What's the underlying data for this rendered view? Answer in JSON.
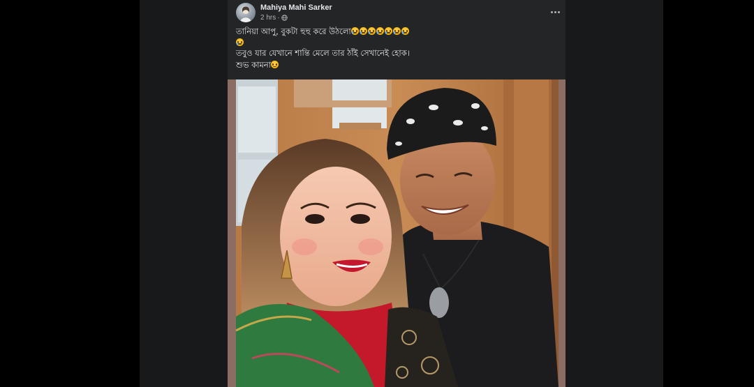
{
  "post": {
    "author": "Mahiya Mahi Sarker",
    "time": "2 hrs",
    "separator": "·",
    "privacy_icon": "globe-icon",
    "more_icon": "more-horizontal-icon",
    "lines": [
      "তানিয়া আপু, বুকটা হুহু করে উঠলো",
      "তবুও যার যেখানে শান্তি মেলে তার ঠাঁই সেখানেই হোক।",
      "শুভ কামনা"
    ],
    "line1_emoji": "crying-face x7",
    "line2_emoji": "crying-face",
    "line4_emoji": "sad-face",
    "photo_description_icon": "photo"
  },
  "colors": {
    "card_bg": "#242526",
    "page_bg": "#18191a",
    "outer_bg": "#000000",
    "text_primary": "#e4e6eb",
    "text_secondary": "#b0b3b8"
  }
}
